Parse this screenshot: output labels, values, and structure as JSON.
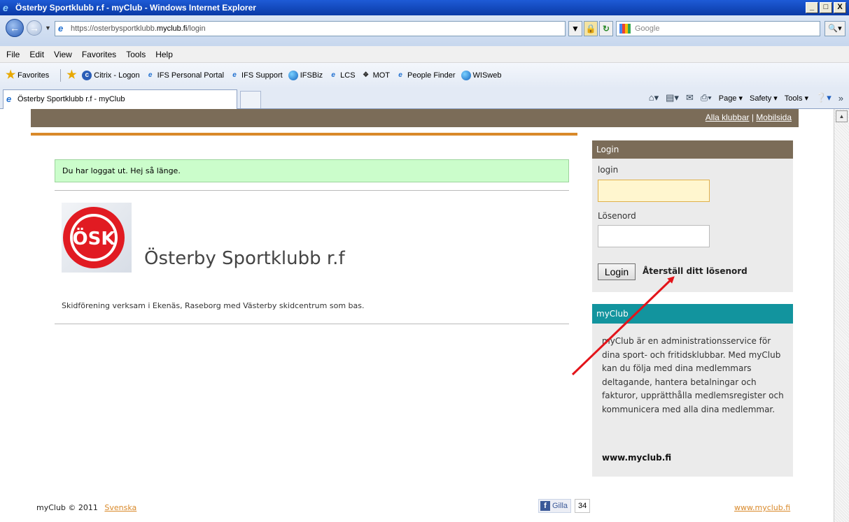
{
  "window": {
    "title": "Österby Sportklubb r.f - myClub - Windows Internet Explorer",
    "controls": [
      "_",
      "□",
      "X"
    ]
  },
  "address": {
    "url_prefix": "https://osterbysportklubb.",
    "url_domain": "myclub.fi",
    "url_path": "/login",
    "search_placeholder": "Google"
  },
  "menu": [
    "File",
    "Edit",
    "View",
    "Favorites",
    "Tools",
    "Help"
  ],
  "favorites": {
    "label": "Favorites",
    "items": [
      "Citrix - Logon",
      "IFS Personal Portal",
      "IFS Support",
      "IFSBiz",
      "LCS",
      "MOT",
      "People Finder",
      "WISweb"
    ]
  },
  "tab": {
    "title": "Österby Sportklubb r.f - myClub"
  },
  "commands": [
    "Page ▾",
    "Safety ▾",
    "Tools ▾"
  ],
  "page": {
    "top_links": [
      "Alla klubbar",
      "Mobilsida"
    ],
    "top_links_sep": "|",
    "notice": "Du har loggat ut. Hej så länge.",
    "club_logo_text": "ÖSK",
    "club_name": "Österby Sportklubb r.f",
    "club_desc": "Skidförening verksam i Ekenäs, Raseborg med Västerby skidcentrum som bas."
  },
  "login": {
    "heading": "Login",
    "username_label": "login",
    "password_label": "Lösenord",
    "button": "Login",
    "reset_link": "Återställ ditt lösenord"
  },
  "myclub": {
    "heading": "myClub",
    "description": "myClub är en administrationsservice för dina sport- och fritidsklubbar. Med myClub kan du följa med dina medlemmars deltagande, hantera betalningar och fakturor, upprätthålla medlemsregister och kommunicera med alla dina medlemmar.",
    "url": "www.myclub.fi"
  },
  "footer": {
    "copyright": "myClub © 2011",
    "language": "Svenska",
    "like_label": "Gilla",
    "like_count": "34",
    "url": "www.myclub.fi"
  },
  "colors": {
    "brand_brown": "#7b6c58",
    "brand_orange": "#d9892a",
    "brand_teal": "#12949e",
    "notice_green": "#cbfdcb",
    "annotation_arrow": "#e3141a"
  }
}
